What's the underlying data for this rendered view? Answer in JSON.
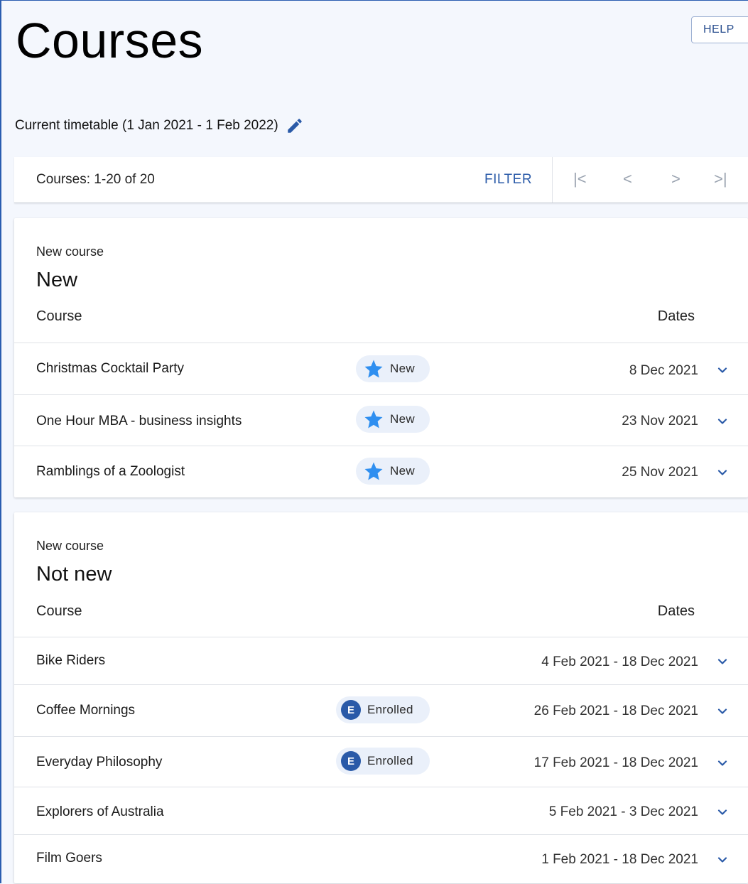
{
  "header": {
    "title": "Courses",
    "help_label": "HELP",
    "timetable_label": "Current timetable (1 Jan 2021 - 1 Feb 2022)"
  },
  "toolbar": {
    "count_label": "Courses: 1-20 of 20",
    "filter_label": "FILTER",
    "first_page": "|<",
    "prev_page": "<",
    "next_page": ">",
    "last_page": ">|"
  },
  "groups": [
    {
      "label": "New course",
      "title": "New",
      "col_course": "Course",
      "col_dates": "Dates",
      "rows": [
        {
          "name": "Christmas Cocktail Party",
          "badge": "New",
          "badge_icon": "star-icon",
          "dates": "8 Dec 2021"
        },
        {
          "name": "One Hour MBA - business insights",
          "badge": "New",
          "badge_icon": "star-icon",
          "dates": "23 Nov 2021"
        },
        {
          "name": "Ramblings of a Zoologist",
          "badge": "New",
          "badge_icon": "star-icon",
          "dates": "25 Nov 2021"
        }
      ]
    },
    {
      "label": "New course",
      "title": "Not new",
      "col_course": "Course",
      "col_dates": "Dates",
      "rows": [
        {
          "name": "Bike Riders",
          "badge": "",
          "dates": "4 Feb 2021 - 18 Dec 2021"
        },
        {
          "name": "Coffee Mornings",
          "badge": "Enrolled",
          "badge_icon": "enrolled-icon",
          "badge_letter": "E",
          "dates": "26 Feb 2021 - 18 Dec 2021"
        },
        {
          "name": "Everyday Philosophy",
          "badge": "Enrolled",
          "badge_icon": "enrolled-icon",
          "badge_letter": "E",
          "dates": "17 Feb 2021 - 18 Dec 2021"
        },
        {
          "name": "Explorers of Australia",
          "badge": "",
          "dates": "5 Feb 2021 - 3 Dec 2021"
        },
        {
          "name": "Film Goers",
          "badge": "",
          "dates": "1 Feb 2021 - 18 Dec 2021"
        }
      ]
    }
  ],
  "colors": {
    "accent": "#2a5aa8",
    "star": "#2f8ff0",
    "badge_bg": "#eaf0fa",
    "page_bg": "#f4f7fd"
  }
}
